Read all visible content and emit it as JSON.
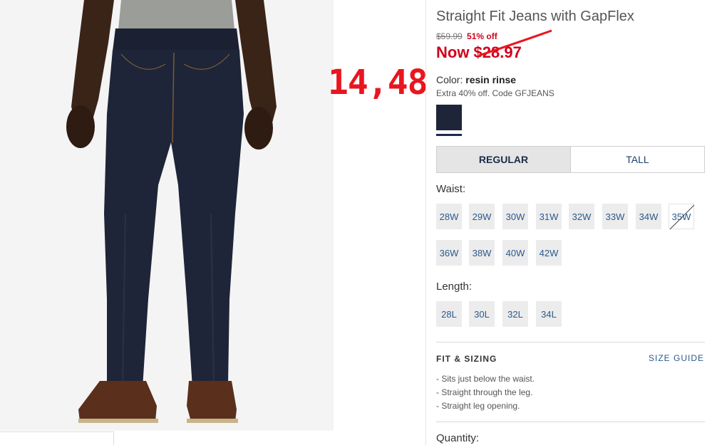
{
  "annotation": {
    "handwritten_price": "14,48"
  },
  "product": {
    "title": "Straight Fit Jeans with GapFlex",
    "original_price": "$59.99",
    "discount": "51% off",
    "now_price": "Now $28.97",
    "color_label": "Color:",
    "color_value": "resin rinse",
    "promo": "Extra 40% off. Code GFJEANS",
    "swatch_color": "#1f2538"
  },
  "fit_tabs": [
    {
      "label": "REGULAR",
      "selected": true
    },
    {
      "label": "TALL",
      "selected": false
    }
  ],
  "waist": {
    "label": "Waist:",
    "sizes": [
      {
        "label": "28W",
        "available": true
      },
      {
        "label": "29W",
        "available": true
      },
      {
        "label": "30W",
        "available": true
      },
      {
        "label": "31W",
        "available": true
      },
      {
        "label": "32W",
        "available": true
      },
      {
        "label": "33W",
        "available": true
      },
      {
        "label": "34W",
        "available": true
      },
      {
        "label": "35W",
        "available": false
      },
      {
        "label": "36W",
        "available": true
      },
      {
        "label": "38W",
        "available": true
      },
      {
        "label": "40W",
        "available": true
      },
      {
        "label": "42W",
        "available": true
      }
    ]
  },
  "length": {
    "label": "Length:",
    "sizes": [
      {
        "label": "28L",
        "available": true
      },
      {
        "label": "30L",
        "available": true
      },
      {
        "label": "32L",
        "available": true
      },
      {
        "label": "34L",
        "available": true
      }
    ]
  },
  "fit_sizing": {
    "heading": "FIT & SIZING",
    "size_guide": "SIZE GUIDE",
    "bullets": [
      "- Sits just below the waist.",
      "- Straight through the leg.",
      "- Straight leg opening."
    ]
  },
  "quantity_label": "Quantity:",
  "colors": {
    "sale_red": "#d0021b",
    "annotation_red": "#e8161f",
    "link_blue": "#2a5a8c",
    "denim": "#1f2538"
  }
}
